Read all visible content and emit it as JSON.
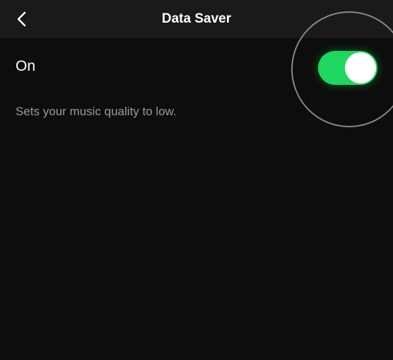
{
  "header": {
    "title": "Data Saver"
  },
  "setting": {
    "label": "On",
    "description": "Sets your music quality to low.",
    "enabled": true
  },
  "colors": {
    "accent": "#1ed760",
    "background": "#0d0d0d",
    "headerBg": "#1a1a1a",
    "textSecondary": "#9a9a9a"
  }
}
